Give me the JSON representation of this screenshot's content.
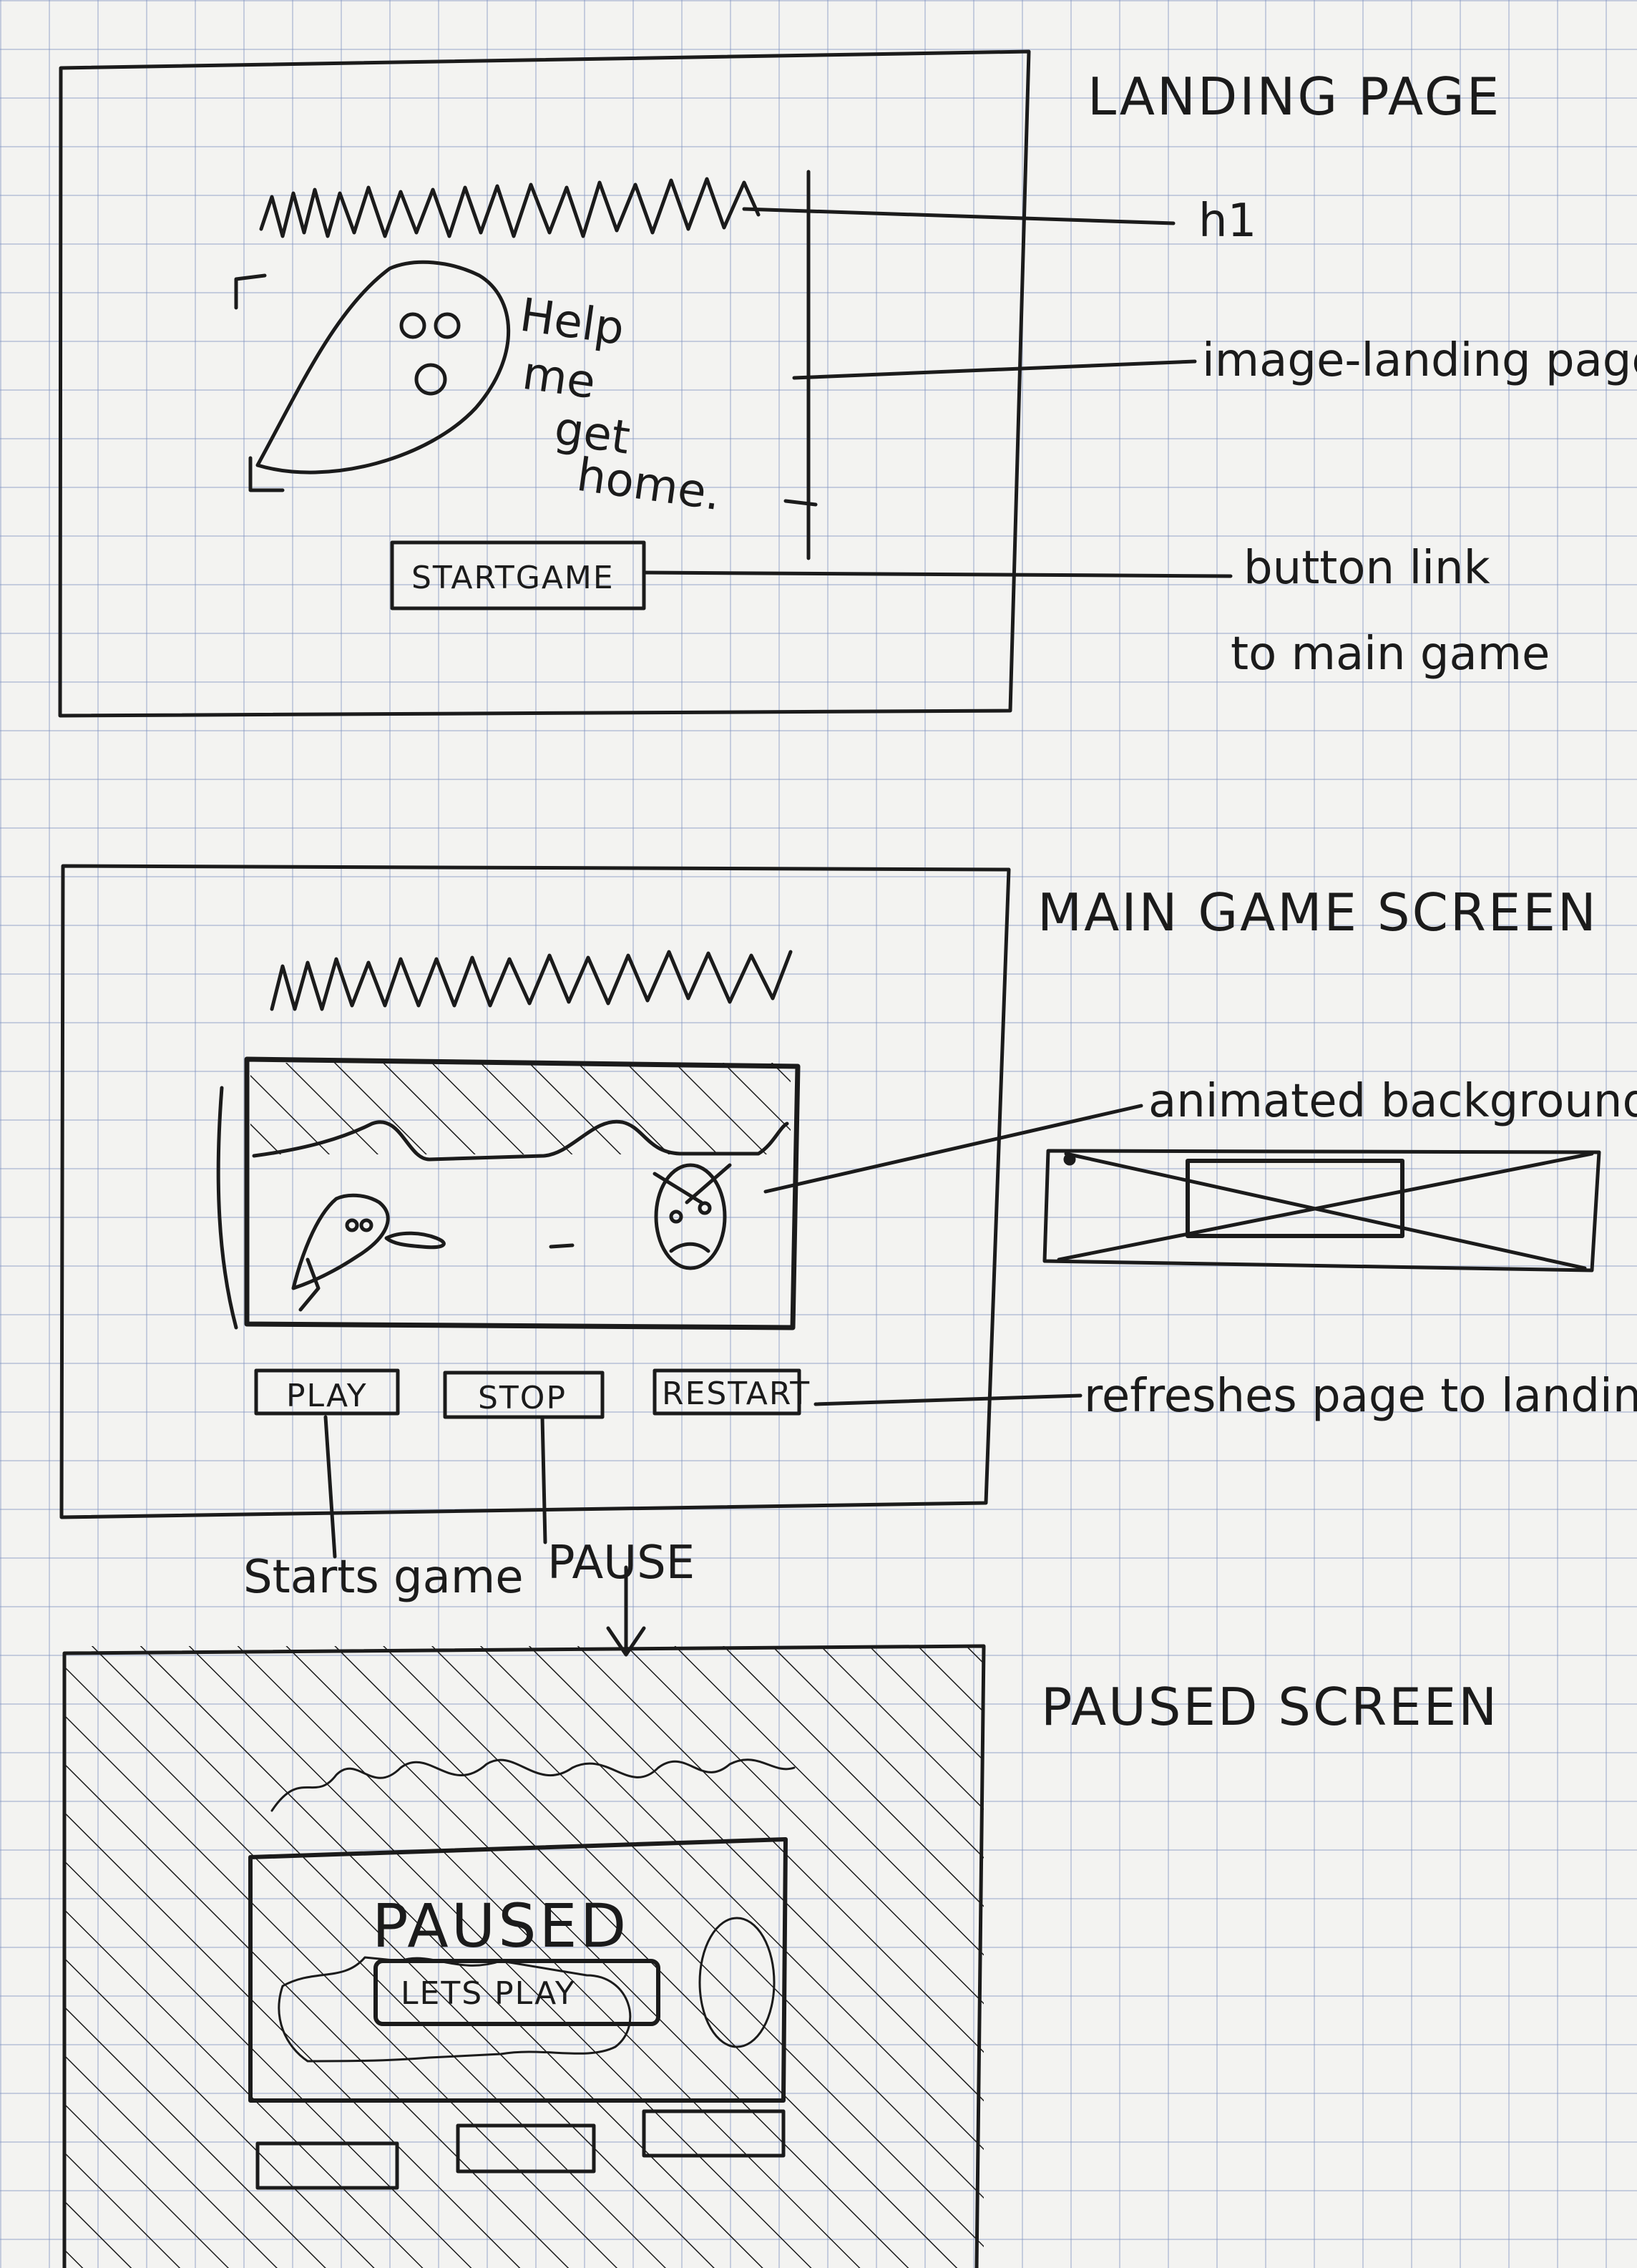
{
  "landing": {
    "title": "LANDING PAGE",
    "h1_label": "h1",
    "speech_text": [
      "Help",
      "me",
      "get",
      "home."
    ],
    "image_label": "image-landing page",
    "start_button": "STARTGAME",
    "button_note": [
      "button link",
      "to main game"
    ]
  },
  "main_game": {
    "title": "MAIN GAME SCREEN",
    "animated_label": "animated background",
    "buttons": {
      "play": "PLAY",
      "stop": "STOP",
      "restart": "RESTART"
    },
    "restart_note": "refreshes page to landing",
    "play_note": "Starts game",
    "stop_note": "PAUSE"
  },
  "paused": {
    "title": "PAUSED SCREEN",
    "paused_text": "PAUSED",
    "resume_button": "LETS PLAY"
  },
  "colors": {
    "ink": "#1b1b1b",
    "paper": "#f3f3f1",
    "grid": "#8c9bc4"
  }
}
